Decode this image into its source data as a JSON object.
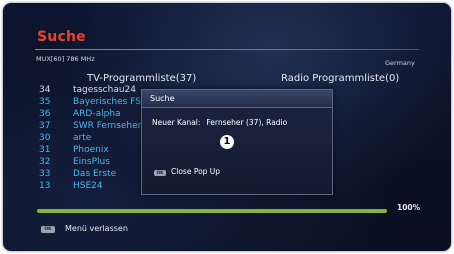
{
  "screen": {
    "title": "Suche",
    "mux": "MUX[60] 786 MHz",
    "country": "Germany",
    "tv_list_header": "TV-Programmliste(37)",
    "radio_list_header": "Radio Programmliste(0)"
  },
  "channels": [
    {
      "num": "34",
      "name": "tagesschau24"
    },
    {
      "num": "35",
      "name": "Bayerisches FS"
    },
    {
      "num": "36",
      "name": "ARD-alpha"
    },
    {
      "num": "37",
      "name": "SWR Fernsehen"
    },
    {
      "num": "30",
      "name": "arte"
    },
    {
      "num": "31",
      "name": "Phoenix"
    },
    {
      "num": "32",
      "name": "EinsPlus"
    },
    {
      "num": "33",
      "name": "Das Erste"
    },
    {
      "num": "13",
      "name": "HSE24"
    }
  ],
  "progress": {
    "value": 100,
    "label": "100%"
  },
  "footer": {
    "key_label": "OK",
    "action_label": "Menü verlassen"
  },
  "popup": {
    "title": "Suche",
    "message_label": "Neuer Kanal:",
    "message_value": "Fernseher (37), Radio",
    "key_label": "OK",
    "action_label": "Close Pop Up"
  },
  "callout": {
    "number": "1"
  },
  "colors": {
    "title": "#e8432b",
    "channel_text": "#4fb4e8",
    "progress": "#86b43a"
  }
}
